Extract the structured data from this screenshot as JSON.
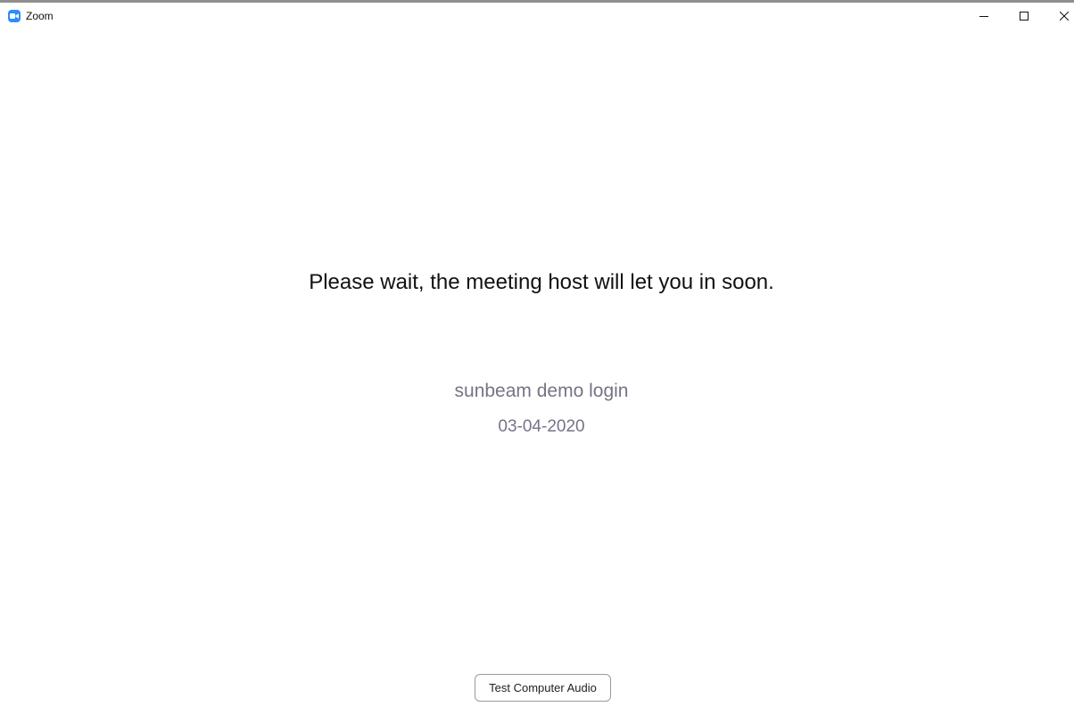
{
  "window": {
    "title": "Zoom",
    "app_icon": "zoom-camera-icon",
    "controls": {
      "minimize_icon": "minimize-icon",
      "maximize_icon": "maximize-icon",
      "close_icon": "close-icon"
    }
  },
  "waiting_room": {
    "message": "Please wait, the meeting host will let you in soon.",
    "meeting_name": "sunbeam demo login",
    "meeting_date": "03-04-2020"
  },
  "footer": {
    "test_audio_label": "Test Computer Audio"
  },
  "colors": {
    "brand_blue": "#2d8cff",
    "primary_text": "#111111",
    "secondary_text": "#747487",
    "button_border": "#9a9aa3",
    "background": "#ffffff"
  }
}
